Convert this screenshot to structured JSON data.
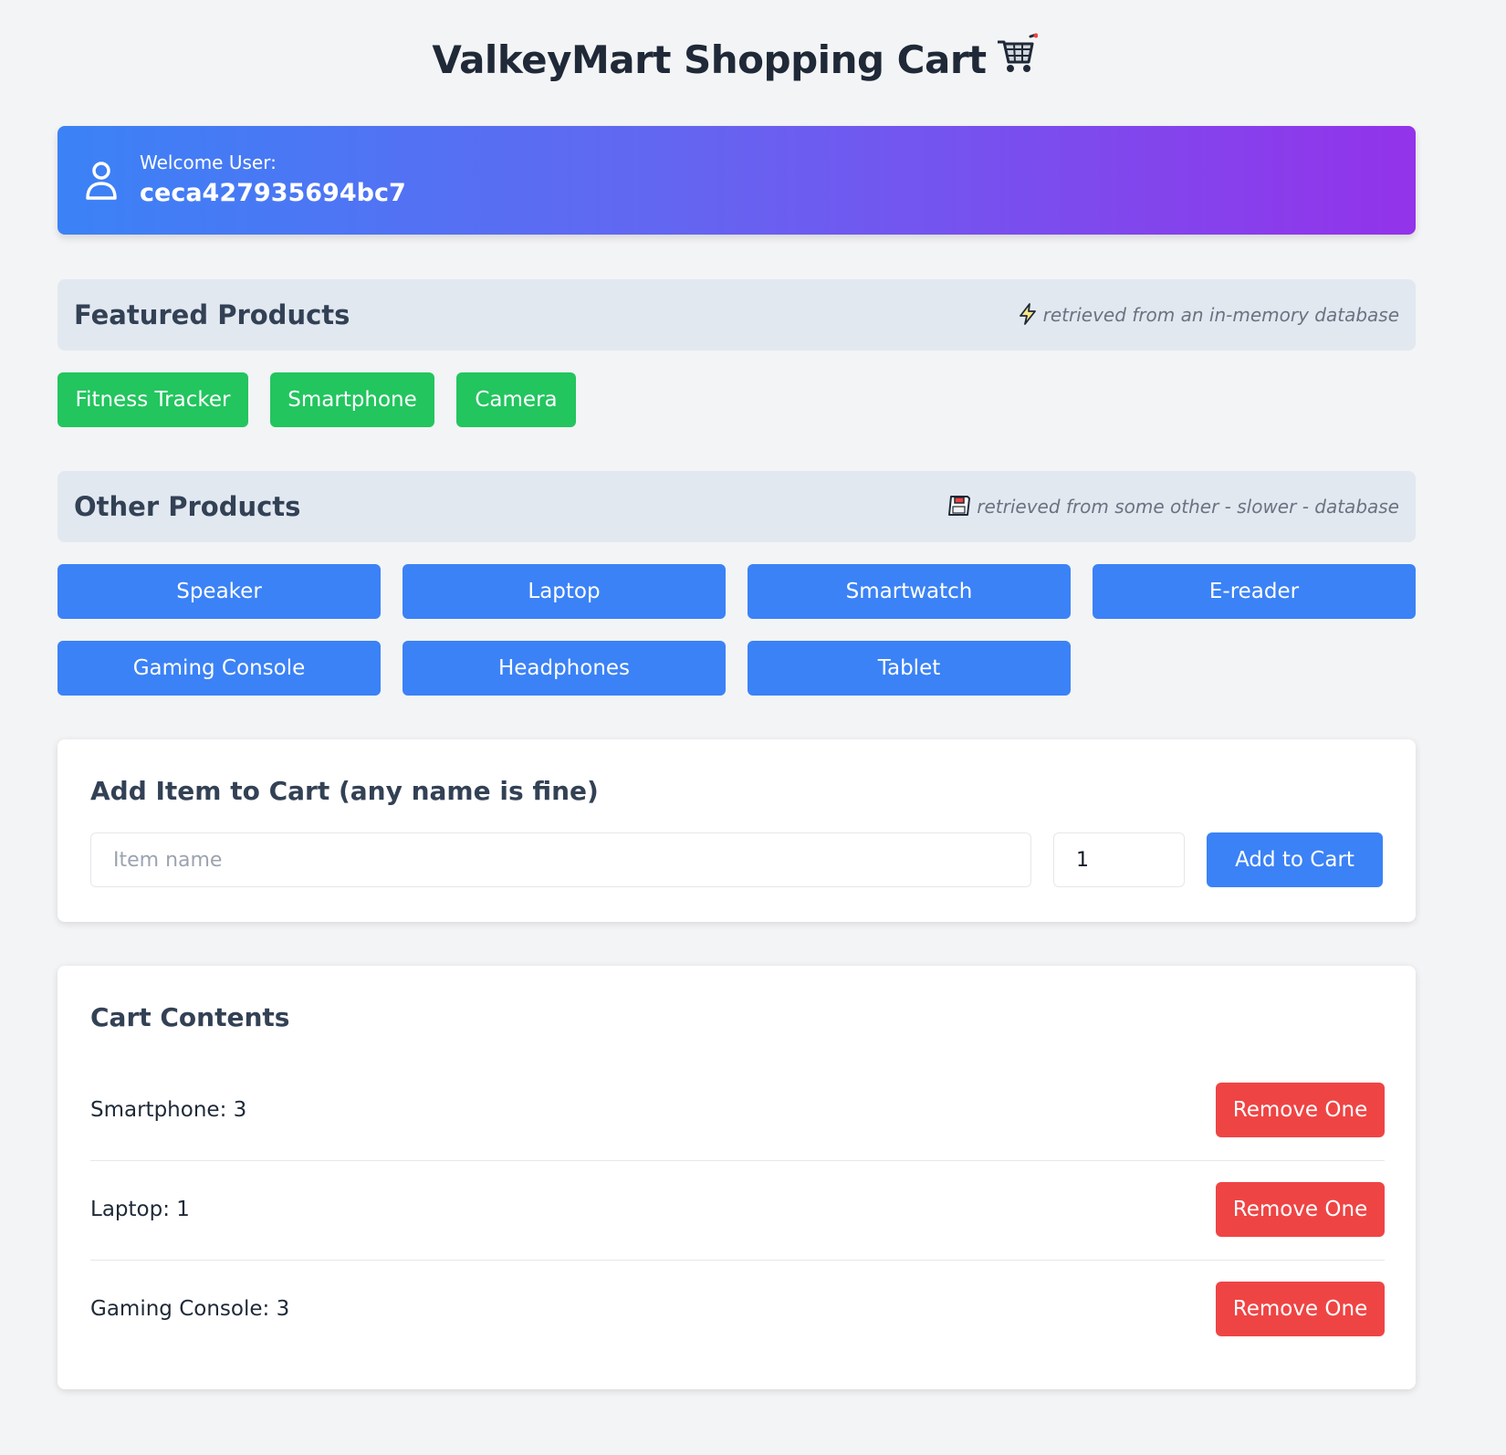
{
  "header": {
    "title": "ValkeyMart Shopping Cart",
    "title_icon": "shopping-cart-emoji"
  },
  "welcome": {
    "label": "Welcome User:",
    "user_id": "ceca427935694bc7",
    "icon": "user-icon",
    "gradient": [
      "#3b82f6",
      "#6366f1",
      "#9333ea"
    ]
  },
  "featured": {
    "title": "Featured Products",
    "note": "retrieved from an in-memory database",
    "note_icon": "lightning-icon",
    "products": [
      "Fitness Tracker",
      "Smartphone",
      "Camera"
    ],
    "color": "#22c55e"
  },
  "other": {
    "title": "Other Products",
    "note": "retrieved from some other - slower - database",
    "note_icon": "floppy-disk-icon",
    "products": [
      "Speaker",
      "Laptop",
      "Smartwatch",
      "E-reader",
      "Gaming Console",
      "Headphones",
      "Tablet"
    ],
    "color": "#3b82f6"
  },
  "add_item": {
    "title": "Add Item to Cart (any name is fine)",
    "name_placeholder": "Item name",
    "name_value": "",
    "quantity_value": "1",
    "button_label": "Add to Cart"
  },
  "cart": {
    "title": "Cart Contents",
    "remove_label": "Remove One",
    "remove_color": "#ef4444",
    "items": [
      {
        "name": "Smartphone",
        "separator": ": ",
        "qty": "3"
      },
      {
        "name": "Laptop",
        "separator": ": ",
        "qty": "1"
      },
      {
        "name": "Gaming Console",
        "separator": ": ",
        "qty": "3"
      }
    ]
  }
}
